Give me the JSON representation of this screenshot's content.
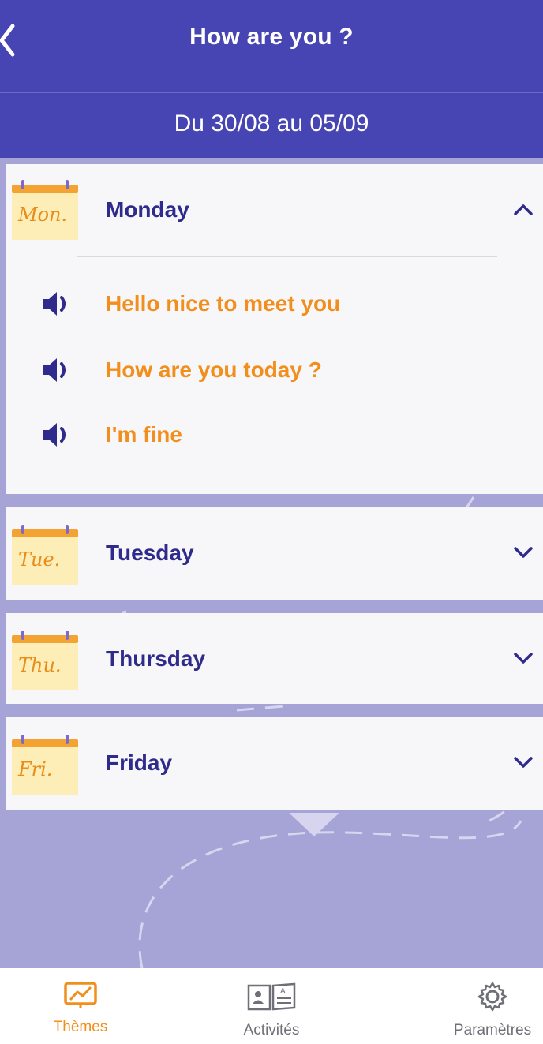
{
  "header": {
    "title": "How are you ?",
    "date_range": "Du 30/08 au 05/09",
    "back_icon": "chevron-left-icon"
  },
  "days": [
    {
      "abbr": "Mon.",
      "name": "Monday",
      "expanded": true,
      "phrases": [
        "Hello nice to meet you",
        "How are you today ?",
        "I'm fine"
      ]
    },
    {
      "abbr": "Tue.",
      "name": "Tuesday",
      "expanded": false
    },
    {
      "abbr": "Thu.",
      "name": "Thursday",
      "expanded": false
    },
    {
      "abbr": "Fri.",
      "name": "Friday",
      "expanded": false
    }
  ],
  "nav": {
    "items": [
      {
        "label": "Thèmes",
        "icon": "chart-icon",
        "active": true
      },
      {
        "label": "Activités",
        "icon": "activity-book-icon",
        "active": false
      },
      {
        "label": "Paramètres",
        "icon": "gear-icon",
        "active": false
      }
    ]
  },
  "colors": {
    "primary": "#4744b3",
    "accent": "#f28e1c",
    "background": "#a6a3d7",
    "card": "#f7f7f9",
    "day_text": "#2f2b8c"
  }
}
